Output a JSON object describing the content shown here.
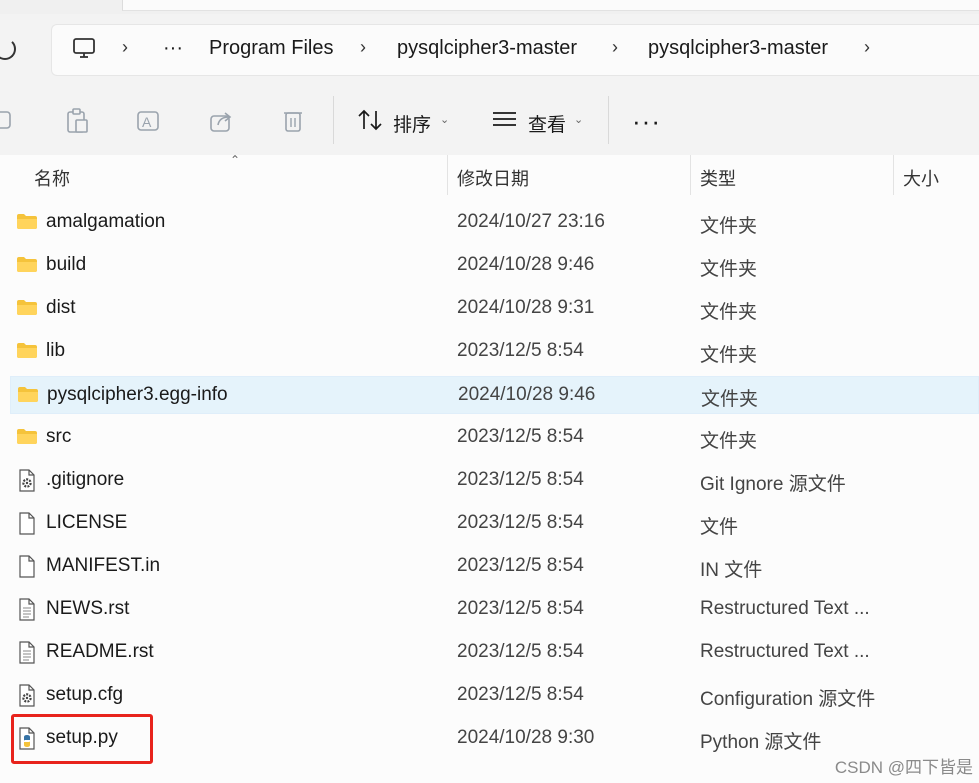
{
  "breadcrumb": {
    "more": "···",
    "items": [
      "Program Files",
      "pysqlcipher3-master",
      "pysqlcipher3-master"
    ]
  },
  "toolbar": {
    "sort_label": "排序",
    "view_label": "查看",
    "more_label": "···"
  },
  "columns": {
    "name": "名称",
    "date": "修改日期",
    "type": "类型",
    "size": "大小"
  },
  "files": [
    {
      "name": "amalgamation",
      "date": "2024/10/27 23:16",
      "type": "文件夹",
      "icon": "folder-icon"
    },
    {
      "name": "build",
      "date": "2024/10/28 9:46",
      "type": "文件夹",
      "icon": "folder-icon"
    },
    {
      "name": "dist",
      "date": "2024/10/28 9:31",
      "type": "文件夹",
      "icon": "folder-icon"
    },
    {
      "name": "lib",
      "date": "2023/12/5 8:54",
      "type": "文件夹",
      "icon": "folder-icon"
    },
    {
      "name": "pysqlcipher3.egg-info",
      "date": "2024/10/28 9:46",
      "type": "文件夹",
      "icon": "folder-icon",
      "selected": true
    },
    {
      "name": "src",
      "date": "2023/12/5 8:54",
      "type": "文件夹",
      "icon": "folder-icon"
    },
    {
      "name": ".gitignore",
      "date": "2023/12/5 8:54",
      "type": "Git Ignore 源文件",
      "icon": "gear-file-icon"
    },
    {
      "name": "LICENSE",
      "date": "2023/12/5 8:54",
      "type": "文件",
      "icon": "blank-file-icon"
    },
    {
      "name": "MANIFEST.in",
      "date": "2023/12/5 8:54",
      "type": "IN 文件",
      "icon": "blank-file-icon"
    },
    {
      "name": "NEWS.rst",
      "date": "2023/12/5 8:54",
      "type": "Restructured Text ...",
      "icon": "text-file-icon"
    },
    {
      "name": "README.rst",
      "date": "2023/12/5 8:54",
      "type": "Restructured Text ...",
      "icon": "text-file-icon"
    },
    {
      "name": "setup.cfg",
      "date": "2023/12/5 8:54",
      "type": "Configuration 源文件",
      "icon": "gear-file-icon"
    },
    {
      "name": "setup.py",
      "date": "2024/10/28 9:30",
      "type": "Python 源文件",
      "icon": "python-file-icon"
    }
  ],
  "watermark": "CSDN @四下皆是",
  "colors": {
    "folder": "#f5c33b",
    "selected_row": "#e5f3fb",
    "highlight_box": "#e8231c"
  }
}
